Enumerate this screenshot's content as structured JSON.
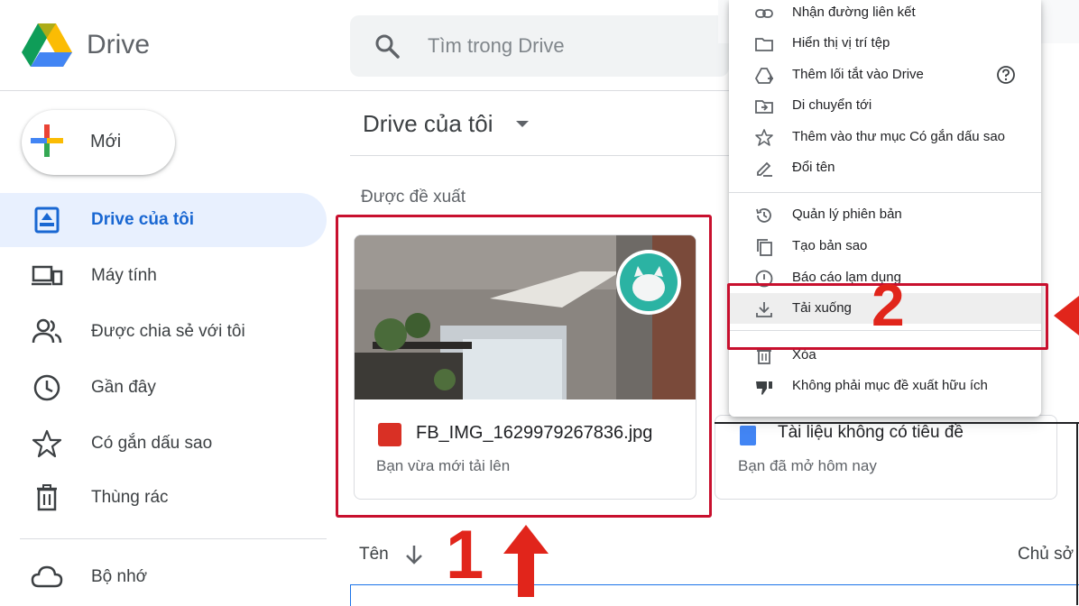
{
  "app": {
    "name": "Drive"
  },
  "search": {
    "placeholder": "Tìm trong Drive"
  },
  "new_button": {
    "label": "Mới"
  },
  "sidebar": {
    "items": [
      {
        "label": "Drive của tôi",
        "icon": "my-drive-icon",
        "active": true
      },
      {
        "label": "Máy tính",
        "icon": "computer-icon"
      },
      {
        "label": "Được chia sẻ với tôi",
        "icon": "shared-icon"
      },
      {
        "label": "Gần đây",
        "icon": "recent-clock-icon"
      },
      {
        "label": "Có gắn dấu sao",
        "icon": "star-icon"
      },
      {
        "label": "Thùng rác",
        "icon": "trash-icon"
      }
    ],
    "storage": {
      "label": "Bộ nhớ",
      "icon": "cloud-icon"
    }
  },
  "main": {
    "title": "Drive của tôi",
    "suggested_label": "Được đề xuất",
    "card": {
      "file_name": "FB_IMG_1629979267836.jpg",
      "subtitle": "Bạn vừa mới tải lên"
    },
    "right_card": {
      "file_name": "Tài liệu không có tiêu đề",
      "subtitle": "Bạn đã mở hôm nay"
    },
    "sort": {
      "name_label": "Tên",
      "owner_label": "Chủ sở"
    }
  },
  "context_menu": {
    "items": [
      {
        "label": "Nhận đường liên kết",
        "icon": "link-icon"
      },
      {
        "label": "Hiển thị vị trí tệp",
        "icon": "folder-icon"
      },
      {
        "label": "Thêm lối tắt vào Drive",
        "icon": "add-shortcut-icon"
      },
      {
        "label": "Di chuyển tới",
        "icon": "move-to-icon"
      },
      {
        "label": "Thêm vào thư mục Có gắn dấu sao",
        "icon": "star-icon"
      },
      {
        "label": "Đổi tên",
        "icon": "rename-pencil-icon"
      },
      {
        "label": "Quản lý phiên bản",
        "icon": "version-history-icon"
      },
      {
        "label": "Tạo bản sao",
        "icon": "copy-icon"
      },
      {
        "label": "Báo cáo lạm dụng",
        "icon": "report-icon"
      },
      {
        "label": "Tải xuống",
        "icon": "download-icon"
      },
      {
        "label": "Xóa",
        "icon": "trash-icon"
      },
      {
        "label": "Không phải mục đề xuất hữu ích",
        "icon": "thumbs-down-icon"
      }
    ]
  },
  "annotations": {
    "step1": "1",
    "step2": "2"
  },
  "colors": {
    "accent": "#1967d2",
    "highlight": "#c8102e",
    "annotation": "#e1251b"
  }
}
